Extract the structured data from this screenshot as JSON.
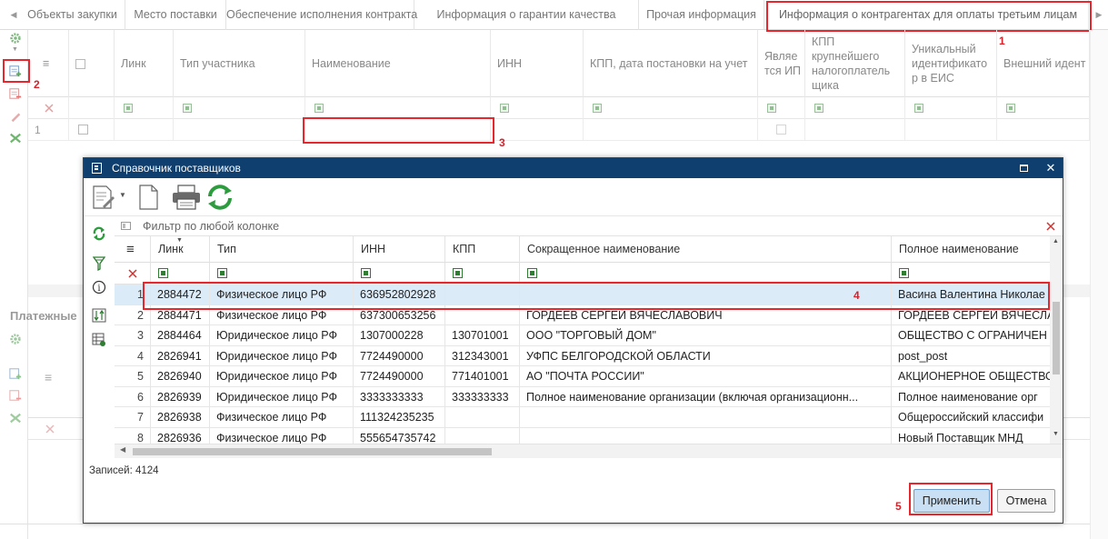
{
  "tabs": [
    "Объекты закупки",
    "Место поставки",
    "Обеспечение исполнения контракта",
    "Информация о гарантии качества",
    "Прочая информация",
    "Информация о контрагентах для оплаты третьим лицам"
  ],
  "bg_grid": {
    "columns": [
      "Линк",
      "Тип участника",
      "Наименование",
      "ИНН",
      "КПП, дата постановки на учет",
      "Являе тся ИП",
      "КПП крупнейшего налогоплатель щика",
      "Уникальный идентификато р в ЕИС",
      "Внешний идент"
    ],
    "row_number": "1"
  },
  "section_title": "Платежные",
  "annotations": [
    "1",
    "2",
    "3",
    "4",
    "5"
  ],
  "dialog": {
    "title": "Справочник поставщиков",
    "filter_placeholder": "Фильтр по любой колонке",
    "columns": [
      "Линк",
      "Тип",
      "ИНН",
      "КПП",
      "Сокращенное наименование",
      "Полное наименование"
    ],
    "rows": [
      {
        "n": "1",
        "link": "2884472",
        "type": "Физическое лицо РФ",
        "inn": "636952802928",
        "kpp": "",
        "short": "",
        "full": "Васина Валентина Николае"
      },
      {
        "n": "2",
        "link": "2884471",
        "type": "Физическое лицо РФ",
        "inn": "637300653256",
        "kpp": "",
        "short": "ГОРДЕЕВ СЕРГЕЙ ВЯЧЕСЛАВОВИЧ",
        "full": "ГОРДЕЕВ СЕРГЕЙ ВЯЧЕСЛА"
      },
      {
        "n": "3",
        "link": "2884464",
        "type": "Юридическое лицо РФ",
        "inn": "1307000228",
        "kpp": "130701001",
        "short": "ООО \"ТОРГОВЫЙ ДОМ\"",
        "full": "ОБЩЕСТВО С ОГРАНИЧЕН"
      },
      {
        "n": "4",
        "link": "2826941",
        "type": "Юридическое лицо РФ",
        "inn": "7724490000",
        "kpp": "312343001",
        "short": "УФПС БЕЛГОРОДСКОЙ ОБЛАСТИ",
        "full": "post_post"
      },
      {
        "n": "5",
        "link": "2826940",
        "type": "Юридическое лицо РФ",
        "inn": "7724490000",
        "kpp": "771401001",
        "short": "АО \"ПОЧТА РОССИИ\"",
        "full": "АКЦИОНЕРНОЕ ОБЩЕСТВО"
      },
      {
        "n": "6",
        "link": "2826939",
        "type": "Юридическое лицо РФ",
        "inn": "3333333333",
        "kpp": "333333333",
        "short": "Полное наименование организации (включая организационн...",
        "full": "Полное наименование орг"
      },
      {
        "n": "7",
        "link": "2826938",
        "type": "Физическое лицо РФ",
        "inn": "111324235235",
        "kpp": "",
        "short": "",
        "full": "Общероссийский классифи"
      },
      {
        "n": "8",
        "link": "2826936",
        "type": "Физическое лицо РФ",
        "inn": "555654735742",
        "kpp": "",
        "short": "",
        "full": "Новый Поставщик МНД"
      }
    ],
    "records_label": "Записей: 4124",
    "apply_label": "Применить",
    "cancel_label": "Отмена"
  },
  "colors": {
    "accent_red": "#e8262d",
    "title_bar": "#0f3f6f",
    "selected_row": "#dcebf8",
    "icon_green": "#2e9b3e"
  }
}
